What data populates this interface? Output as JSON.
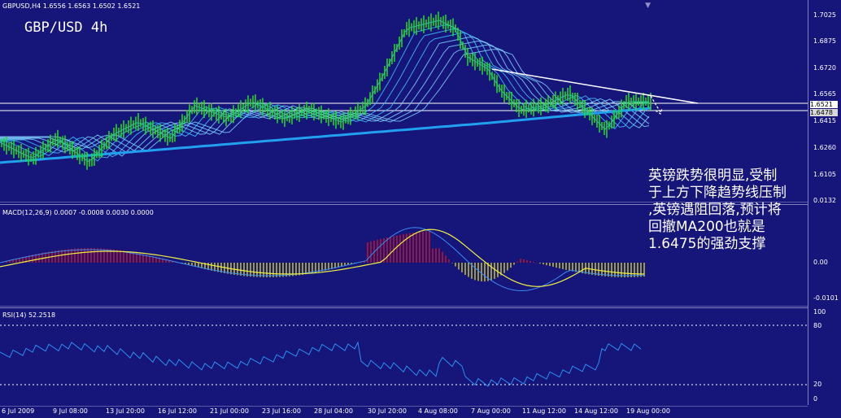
{
  "header": {
    "symbol_line": "GBPUSD,H4  1.6556 1.6563 1.6502 1.6521",
    "title": "GBP/USD 4h"
  },
  "annotation": {
    "lines": [
      "英镑跌势很明显,受制",
      "于上方下降趋势线压制",
      ",英镑遇阻回落,预计将",
      "回撤MA200也就是",
      "1.6475的强劲支撑"
    ]
  },
  "price_axis": {
    "labels": [
      "1.7025",
      "1.6875",
      "1.6720",
      "1.6565",
      "1.6415",
      "1.6260",
      "1.6105"
    ],
    "current": "1.6521",
    "level": "1.6478"
  },
  "macd": {
    "label": "MACD(12,26,9) 0.0007 -0.0008 0.0030 0.0000",
    "axis": [
      "0.0132",
      "0.00",
      "-0.0101"
    ]
  },
  "rsi": {
    "label": "RSI(14) 52.2518",
    "axis": [
      "100",
      "80",
      "20",
      "0"
    ]
  },
  "time_axis": [
    "6 Jul 2009",
    "9 Jul 08:00",
    "13 Jul 20:00",
    "16 Jul 12:00",
    "21 Jul 00:00",
    "23 Jul 16:00",
    "28 Jul 04:00",
    "30 Jul 20:00",
    "4 Aug 08:00",
    "7 Aug 00:00",
    "11 Aug 12:00",
    "14 Aug 12:00",
    "19 Aug 00:00"
  ],
  "colors": {
    "background": "#16157a",
    "candles": "#22e022",
    "ma200": "#22a0f0",
    "macd_positive": "#e01818",
    "macd_negative": "#e0e018",
    "rsi": "#2a90f0",
    "trendline": "#ffffff"
  }
}
